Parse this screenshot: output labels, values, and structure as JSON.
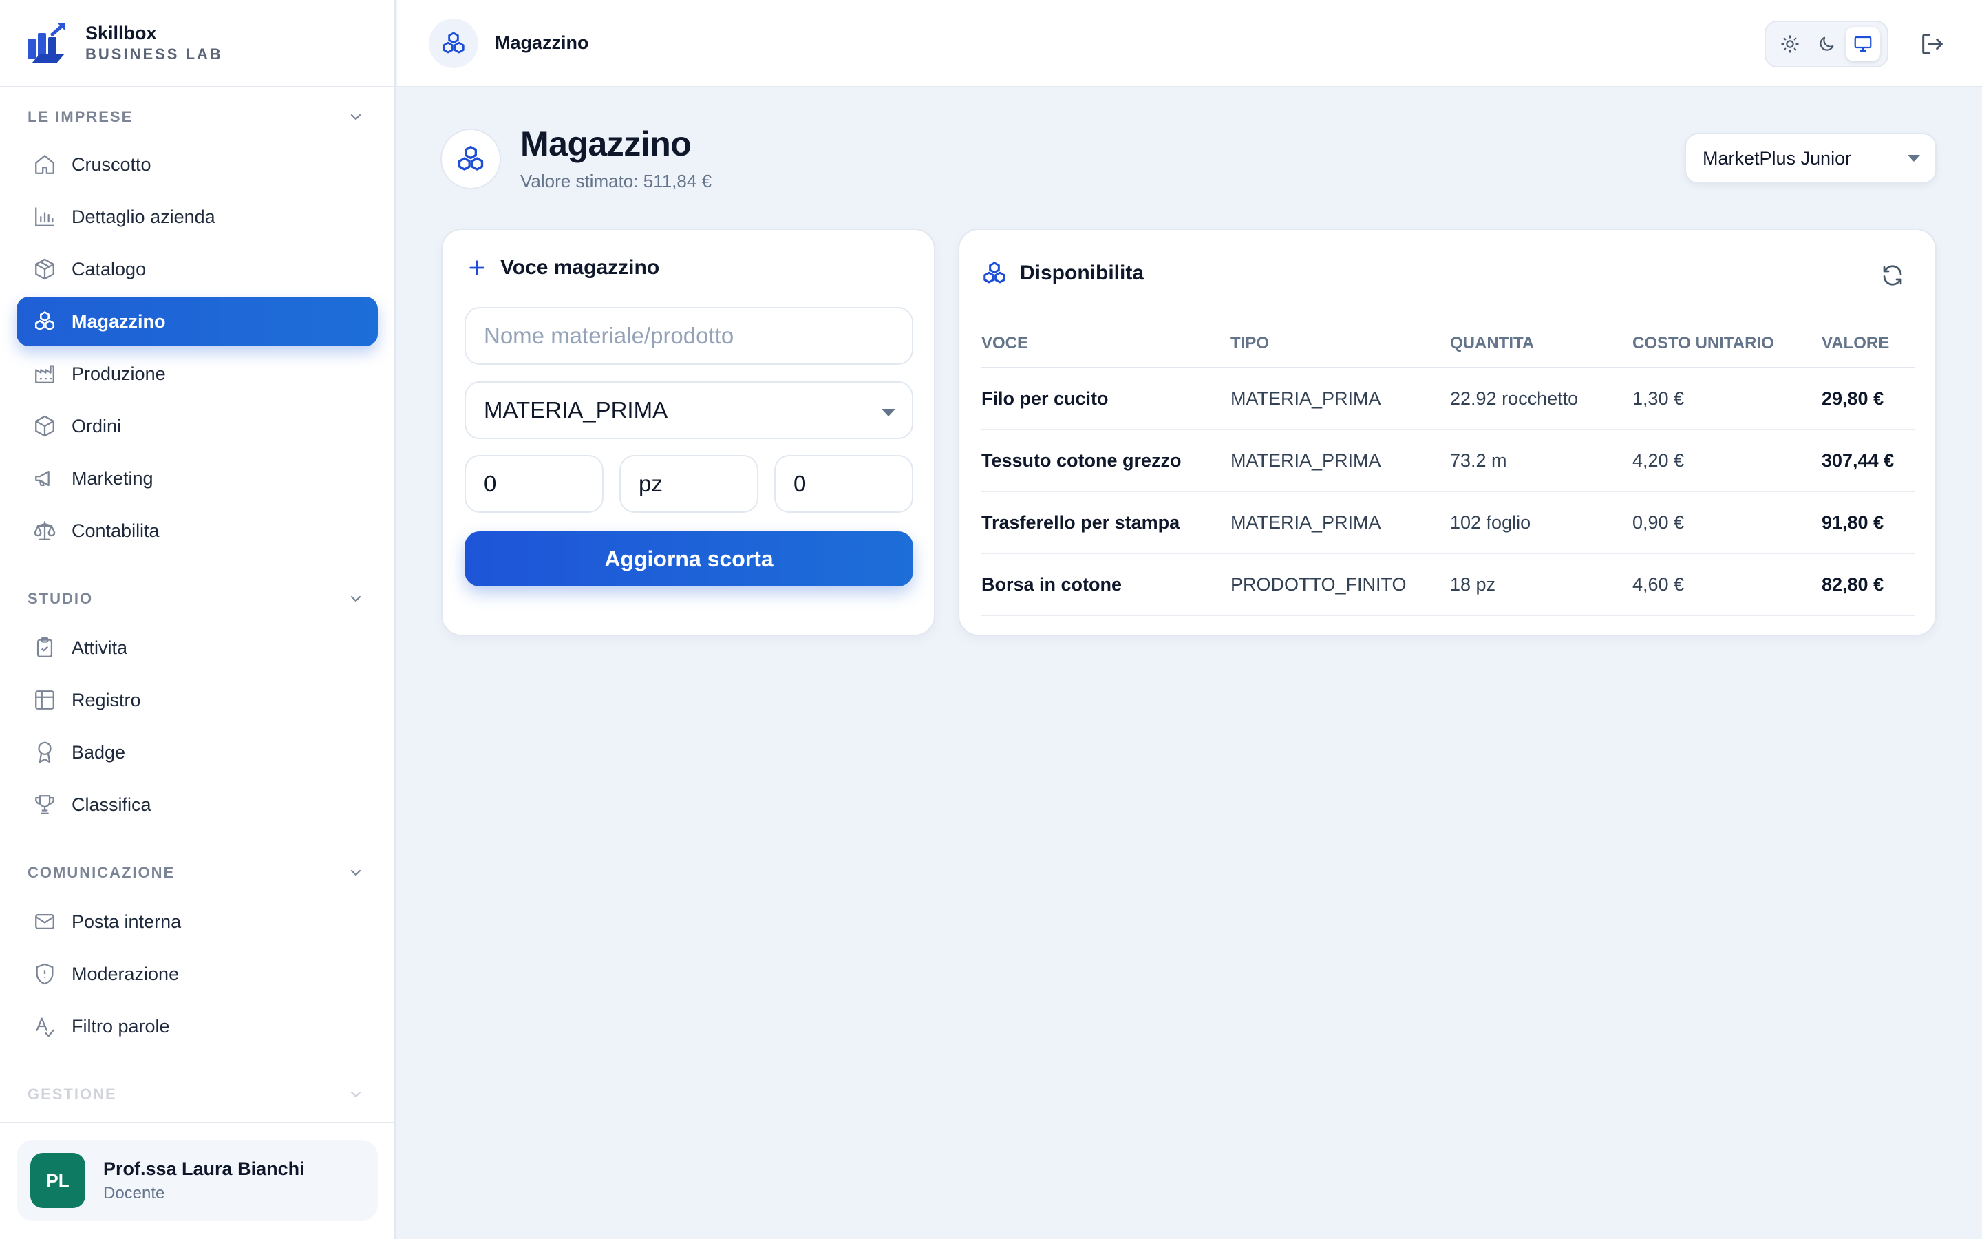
{
  "brand": {
    "name": "Skillbox",
    "subtitle": "BUSINESS LAB"
  },
  "sidebar": {
    "sections": [
      {
        "title": "LE IMPRESE",
        "items": [
          {
            "label": "Cruscotto",
            "icon": "home-icon"
          },
          {
            "label": "Dettaglio azienda",
            "icon": "bar-chart-icon"
          },
          {
            "label": "Catalogo",
            "icon": "box-icon"
          },
          {
            "label": "Magazzino",
            "icon": "boxes-icon",
            "active": true
          },
          {
            "label": "Produzione",
            "icon": "factory-icon"
          },
          {
            "label": "Ordini",
            "icon": "package-icon"
          },
          {
            "label": "Marketing",
            "icon": "megaphone-icon"
          },
          {
            "label": "Contabilita",
            "icon": "scale-icon"
          }
        ]
      },
      {
        "title": "STUDIO",
        "items": [
          {
            "label": "Attivita",
            "icon": "clipboard-check-icon"
          },
          {
            "label": "Registro",
            "icon": "table-icon"
          },
          {
            "label": "Badge",
            "icon": "award-icon"
          },
          {
            "label": "Classifica",
            "icon": "trophy-icon"
          }
        ]
      },
      {
        "title": "COMUNICAZIONE",
        "items": [
          {
            "label": "Posta interna",
            "icon": "mail-icon"
          },
          {
            "label": "Moderazione",
            "icon": "shield-icon"
          },
          {
            "label": "Filtro parole",
            "icon": "spell-check-icon"
          }
        ]
      },
      {
        "title": "GESTIONE",
        "items": []
      }
    ]
  },
  "user": {
    "initials": "PL",
    "name": "Prof.ssa Laura Bianchi",
    "role": "Docente"
  },
  "topbar": {
    "title": "Magazzino"
  },
  "page": {
    "title": "Magazzino",
    "subtitle": "Valore stimato: 511,84 €",
    "company": "MarketPlus Junior"
  },
  "form": {
    "title": "Voce magazzino",
    "name_placeholder": "Nome materiale/prodotto",
    "type_value": "MATERIA_PRIMA",
    "quantity_value": "0",
    "unit_value": "pz",
    "cost_value": "0",
    "submit_label": "Aggiorna scorta"
  },
  "inventory": {
    "title": "Disponibilita",
    "columns": [
      "VOCE",
      "TIPO",
      "QUANTITA",
      "COSTO UNITARIO",
      "VALORE"
    ],
    "rows": [
      {
        "voce": "Filo per cucito",
        "tipo": "MATERIA_PRIMA",
        "quantita": "22.92 rocchetto",
        "costo": "1,30 €",
        "valore": "29,80 €"
      },
      {
        "voce": "Tessuto cotone grezzo",
        "tipo": "MATERIA_PRIMA",
        "quantita": "73.2 m",
        "costo": "4,20 €",
        "valore": "307,44 €"
      },
      {
        "voce": "Trasferello per stampa",
        "tipo": "MATERIA_PRIMA",
        "quantita": "102 foglio",
        "costo": "0,90 €",
        "valore": "91,80 €"
      },
      {
        "voce": "Borsa in cotone",
        "tipo": "PRODOTTO_FINITO",
        "quantita": "18 pz",
        "costo": "4,60 €",
        "valore": "82,80 €"
      }
    ]
  },
  "colors": {
    "accent": "#1d4ed8",
    "active_nav": "#1f5fd6",
    "avatar": "#0f7a62",
    "background": "#eef2f9"
  }
}
